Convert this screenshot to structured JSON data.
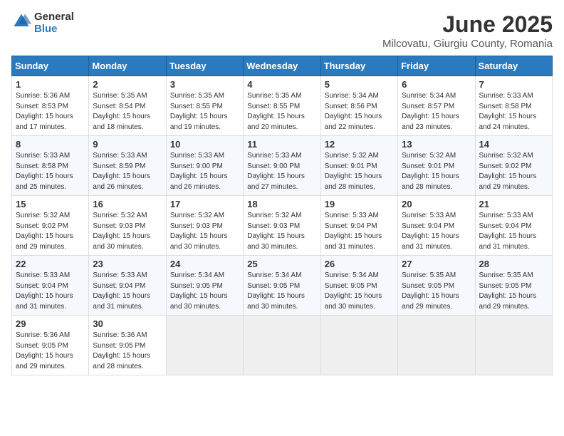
{
  "logo": {
    "general": "General",
    "blue": "Blue"
  },
  "title": "June 2025",
  "location": "Milcovatu, Giurgiu County, Romania",
  "weekdays": [
    "Sunday",
    "Monday",
    "Tuesday",
    "Wednesday",
    "Thursday",
    "Friday",
    "Saturday"
  ],
  "weeks": [
    [
      {
        "day": "1",
        "sunrise": "5:36 AM",
        "sunset": "8:53 PM",
        "daylight": "15 hours and 17 minutes."
      },
      {
        "day": "2",
        "sunrise": "5:35 AM",
        "sunset": "8:54 PM",
        "daylight": "15 hours and 18 minutes."
      },
      {
        "day": "3",
        "sunrise": "5:35 AM",
        "sunset": "8:55 PM",
        "daylight": "15 hours and 19 minutes."
      },
      {
        "day": "4",
        "sunrise": "5:35 AM",
        "sunset": "8:55 PM",
        "daylight": "15 hours and 20 minutes."
      },
      {
        "day": "5",
        "sunrise": "5:34 AM",
        "sunset": "8:56 PM",
        "daylight": "15 hours and 22 minutes."
      },
      {
        "day": "6",
        "sunrise": "5:34 AM",
        "sunset": "8:57 PM",
        "daylight": "15 hours and 23 minutes."
      },
      {
        "day": "7",
        "sunrise": "5:33 AM",
        "sunset": "8:58 PM",
        "daylight": "15 hours and 24 minutes."
      }
    ],
    [
      {
        "day": "8",
        "sunrise": "5:33 AM",
        "sunset": "8:58 PM",
        "daylight": "15 hours and 25 minutes."
      },
      {
        "day": "9",
        "sunrise": "5:33 AM",
        "sunset": "8:59 PM",
        "daylight": "15 hours and 26 minutes."
      },
      {
        "day": "10",
        "sunrise": "5:33 AM",
        "sunset": "9:00 PM",
        "daylight": "15 hours and 26 minutes."
      },
      {
        "day": "11",
        "sunrise": "5:33 AM",
        "sunset": "9:00 PM",
        "daylight": "15 hours and 27 minutes."
      },
      {
        "day": "12",
        "sunrise": "5:32 AM",
        "sunset": "9:01 PM",
        "daylight": "15 hours and 28 minutes."
      },
      {
        "day": "13",
        "sunrise": "5:32 AM",
        "sunset": "9:01 PM",
        "daylight": "15 hours and 28 minutes."
      },
      {
        "day": "14",
        "sunrise": "5:32 AM",
        "sunset": "9:02 PM",
        "daylight": "15 hours and 29 minutes."
      }
    ],
    [
      {
        "day": "15",
        "sunrise": "5:32 AM",
        "sunset": "9:02 PM",
        "daylight": "15 hours and 29 minutes."
      },
      {
        "day": "16",
        "sunrise": "5:32 AM",
        "sunset": "9:03 PM",
        "daylight": "15 hours and 30 minutes."
      },
      {
        "day": "17",
        "sunrise": "5:32 AM",
        "sunset": "9:03 PM",
        "daylight": "15 hours and 30 minutes."
      },
      {
        "day": "18",
        "sunrise": "5:32 AM",
        "sunset": "9:03 PM",
        "daylight": "15 hours and 30 minutes."
      },
      {
        "day": "19",
        "sunrise": "5:33 AM",
        "sunset": "9:04 PM",
        "daylight": "15 hours and 31 minutes."
      },
      {
        "day": "20",
        "sunrise": "5:33 AM",
        "sunset": "9:04 PM",
        "daylight": "15 hours and 31 minutes."
      },
      {
        "day": "21",
        "sunrise": "5:33 AM",
        "sunset": "9:04 PM",
        "daylight": "15 hours and 31 minutes."
      }
    ],
    [
      {
        "day": "22",
        "sunrise": "5:33 AM",
        "sunset": "9:04 PM",
        "daylight": "15 hours and 31 minutes."
      },
      {
        "day": "23",
        "sunrise": "5:33 AM",
        "sunset": "9:04 PM",
        "daylight": "15 hours and 31 minutes."
      },
      {
        "day": "24",
        "sunrise": "5:34 AM",
        "sunset": "9:05 PM",
        "daylight": "15 hours and 30 minutes."
      },
      {
        "day": "25",
        "sunrise": "5:34 AM",
        "sunset": "9:05 PM",
        "daylight": "15 hours and 30 minutes."
      },
      {
        "day": "26",
        "sunrise": "5:34 AM",
        "sunset": "9:05 PM",
        "daylight": "15 hours and 30 minutes."
      },
      {
        "day": "27",
        "sunrise": "5:35 AM",
        "sunset": "9:05 PM",
        "daylight": "15 hours and 29 minutes."
      },
      {
        "day": "28",
        "sunrise": "5:35 AM",
        "sunset": "9:05 PM",
        "daylight": "15 hours and 29 minutes."
      }
    ],
    [
      {
        "day": "29",
        "sunrise": "5:36 AM",
        "sunset": "9:05 PM",
        "daylight": "15 hours and 29 minutes."
      },
      {
        "day": "30",
        "sunrise": "5:36 AM",
        "sunset": "9:05 PM",
        "daylight": "15 hours and 28 minutes."
      },
      null,
      null,
      null,
      null,
      null
    ]
  ]
}
